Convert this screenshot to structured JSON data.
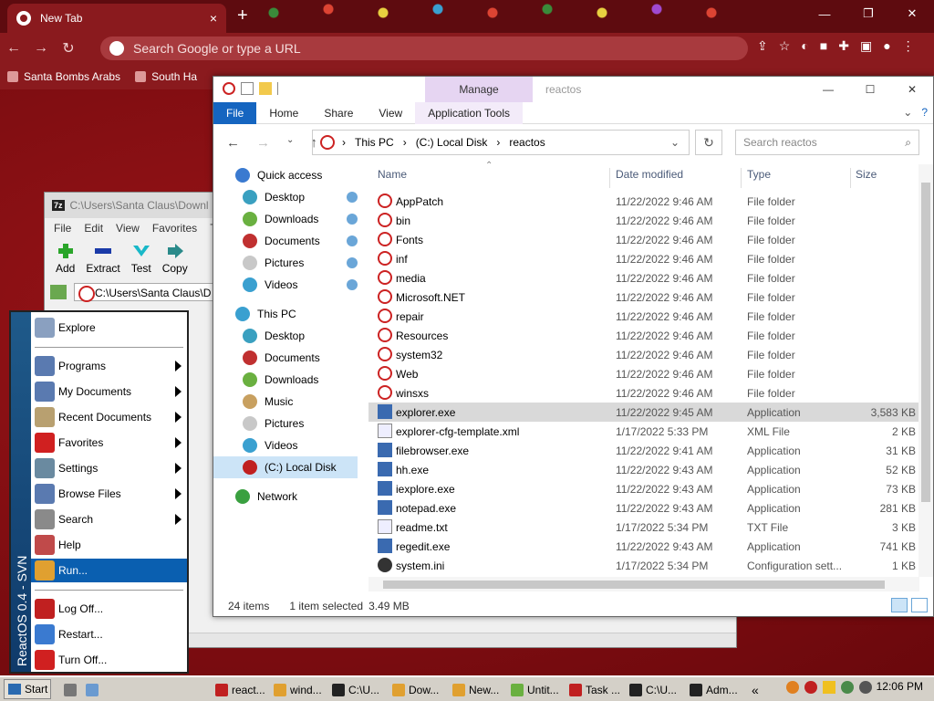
{
  "chrome": {
    "tab_title": "New Tab",
    "tab_close": "×",
    "new_tab": "+",
    "omnibox_placeholder": "Search Google or type a URL",
    "bookmarks": [
      {
        "label": "Santa Bombs Arabs"
      },
      {
        "label": "South Ha"
      }
    ],
    "window_minimize": "—",
    "window_maximize": "❐",
    "window_close": "✕"
  },
  "zip": {
    "title": "C:\\Users\\Santa Claus\\Downl",
    "logo": "7z",
    "menu": [
      "File",
      "Edit",
      "View",
      "Favorites",
      "T"
    ],
    "tools": [
      {
        "label": "Add",
        "color": "#2aa52a"
      },
      {
        "label": "Extract",
        "color": "#1a3aa8"
      },
      {
        "label": "Test",
        "color": "#18b8c8"
      },
      {
        "label": "Copy",
        "color": "#2a8a8a"
      }
    ],
    "path": "C:\\Users\\Santa Claus\\D"
  },
  "start_menu": {
    "brand": "ReactOS 0.4 - SVN",
    "items": [
      {
        "label": "Explore",
        "icon": "explore-icon",
        "color": "#8aa0c0",
        "submenu": false
      },
      {
        "label": "Programs",
        "icon": "programs-icon",
        "color": "#5a7ab0",
        "submenu": true
      },
      {
        "label": "My Documents",
        "icon": "documents-icon",
        "color": "#5a7ab0",
        "submenu": true
      },
      {
        "label": "Recent Documents",
        "icon": "recent-icon",
        "color": "#b8a070",
        "submenu": true
      },
      {
        "label": "Favorites",
        "icon": "heart-icon",
        "color": "#d02020",
        "submenu": true
      },
      {
        "label": "Settings",
        "icon": "settings-icon",
        "color": "#6a8aa0",
        "submenu": true
      },
      {
        "label": "Browse Files",
        "icon": "folder-icon",
        "color": "#5a7ab0",
        "submenu": true
      },
      {
        "label": "Search",
        "icon": "search-icon",
        "color": "#8a8a8a",
        "submenu": true
      },
      {
        "label": "Help",
        "icon": "help-icon",
        "color": "#c04a4a",
        "submenu": false
      },
      {
        "label": "Run...",
        "icon": "run-icon",
        "color": "#e0a030",
        "submenu": false
      },
      {
        "label": "Log Off...",
        "icon": "logoff-icon",
        "color": "#c02020",
        "submenu": false
      },
      {
        "label": "Restart...",
        "icon": "restart-icon",
        "color": "#3a7ad0",
        "submenu": false
      },
      {
        "label": "Turn Off...",
        "icon": "power-icon",
        "color": "#d02020",
        "submenu": false
      }
    ]
  },
  "explorer": {
    "manage_tab": "Manage",
    "title": "reactos",
    "ribbon_tabs": [
      "File",
      "Home",
      "Share",
      "View",
      "Application Tools"
    ],
    "breadcrumb": [
      "This PC",
      "(C:) Local Disk",
      "reactos"
    ],
    "search_placeholder": "Search reactos",
    "nav": [
      {
        "label": "Quick access",
        "color": "#3a7ad0"
      },
      {
        "label": "Desktop",
        "color": "#3aa0c0"
      },
      {
        "label": "Downloads",
        "color": "#6ab040"
      },
      {
        "label": "Documents",
        "color": "#c03030"
      },
      {
        "label": "Pictures",
        "color": "#c8c8c8"
      },
      {
        "label": "Videos",
        "color": "#3aa0d0"
      },
      {
        "label": "This PC",
        "color": "#3aa0d0"
      },
      {
        "label": "Desktop",
        "color": "#3aa0c0"
      },
      {
        "label": "Documents",
        "color": "#c03030"
      },
      {
        "label": "Downloads",
        "color": "#6ab040"
      },
      {
        "label": "Music",
        "color": "#c8a060"
      },
      {
        "label": "Pictures",
        "color": "#c8c8c8"
      },
      {
        "label": "Videos",
        "color": "#3aa0d0"
      },
      {
        "label": "(C:) Local Disk",
        "color": "#c02020"
      },
      {
        "label": "Network",
        "color": "#3aa040"
      }
    ],
    "columns": [
      "Name",
      "Date modified",
      "Type",
      "Size"
    ],
    "files": [
      {
        "name": "AppPatch",
        "date": "11/22/2022 9:46 AM",
        "type": "File folder",
        "size": "",
        "icon": "folder-icon"
      },
      {
        "name": "bin",
        "date": "11/22/2022 9:46 AM",
        "type": "File folder",
        "size": "",
        "icon": "folder-icon"
      },
      {
        "name": "Fonts",
        "date": "11/22/2022 9:46 AM",
        "type": "File folder",
        "size": "",
        "icon": "folder-icon"
      },
      {
        "name": "inf",
        "date": "11/22/2022 9:46 AM",
        "type": "File folder",
        "size": "",
        "icon": "folder-icon"
      },
      {
        "name": "media",
        "date": "11/22/2022 9:46 AM",
        "type": "File folder",
        "size": "",
        "icon": "folder-icon"
      },
      {
        "name": "Microsoft.NET",
        "date": "11/22/2022 9:46 AM",
        "type": "File folder",
        "size": "",
        "icon": "folder-icon"
      },
      {
        "name": "repair",
        "date": "11/22/2022 9:46 AM",
        "type": "File folder",
        "size": "",
        "icon": "folder-icon"
      },
      {
        "name": "Resources",
        "date": "11/22/2022 9:46 AM",
        "type": "File folder",
        "size": "",
        "icon": "folder-icon"
      },
      {
        "name": "system32",
        "date": "11/22/2022 9:46 AM",
        "type": "File folder",
        "size": "",
        "icon": "folder-icon"
      },
      {
        "name": "Web",
        "date": "11/22/2022 9:46 AM",
        "type": "File folder",
        "size": "",
        "icon": "folder-icon"
      },
      {
        "name": "winsxs",
        "date": "11/22/2022 9:46 AM",
        "type": "File folder",
        "size": "",
        "icon": "folder-icon"
      },
      {
        "name": "explorer.exe",
        "date": "11/22/2022 9:45 AM",
        "type": "Application",
        "size": "3,583 KB",
        "icon": "app-icon"
      },
      {
        "name": "explorer-cfg-template.xml",
        "date": "1/17/2022 5:33 PM",
        "type": "XML File",
        "size": "2 KB",
        "icon": "file-icon"
      },
      {
        "name": "filebrowser.exe",
        "date": "11/22/2022 9:41 AM",
        "type": "Application",
        "size": "31 KB",
        "icon": "app-icon"
      },
      {
        "name": "hh.exe",
        "date": "11/22/2022 9:43 AM",
        "type": "Application",
        "size": "52 KB",
        "icon": "app-icon"
      },
      {
        "name": "iexplore.exe",
        "date": "11/22/2022 9:43 AM",
        "type": "Application",
        "size": "73 KB",
        "icon": "app-icon"
      },
      {
        "name": "notepad.exe",
        "date": "11/22/2022 9:43 AM",
        "type": "Application",
        "size": "281 KB",
        "icon": "app-icon"
      },
      {
        "name": "readme.txt",
        "date": "1/17/2022 5:34 PM",
        "type": "TXT File",
        "size": "3 KB",
        "icon": "file-icon"
      },
      {
        "name": "regedit.exe",
        "date": "11/22/2022 9:43 AM",
        "type": "Application",
        "size": "741 KB",
        "icon": "app-icon"
      },
      {
        "name": "system.ini",
        "date": "1/17/2022 5:34 PM",
        "type": "Configuration sett...",
        "size": "1 KB",
        "icon": "settings-file-icon"
      }
    ],
    "selected_index": 11,
    "status_items": "24 items",
    "status_selected": "1 item selected",
    "status_size": "3.49 MB"
  },
  "taskbar": {
    "start": "Start",
    "buttons": [
      {
        "label": "react...",
        "color": "#c02020"
      },
      {
        "label": "wind...",
        "color": "#e0a030"
      },
      {
        "label": "C:\\U...",
        "color": "#222"
      },
      {
        "label": "Dow...",
        "color": "#e0a030"
      },
      {
        "label": "New...",
        "color": "#e0a030"
      },
      {
        "label": "Untit...",
        "color": "#6ab040"
      },
      {
        "label": "Task ...",
        "color": "#c02020"
      },
      {
        "label": "C:\\U...",
        "color": "#222"
      },
      {
        "label": "Adm...",
        "color": "#222"
      }
    ],
    "chevron": "«",
    "clock": "12:06 PM"
  }
}
